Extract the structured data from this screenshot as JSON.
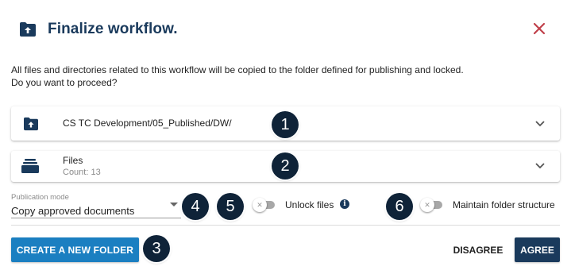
{
  "dialog": {
    "title": "Finalize workflow.",
    "description_line1": "All files and directories related to this workflow will be copied to the folder defined for publishing and locked.",
    "description_line2": "Do you want to proceed?"
  },
  "folder_panel": {
    "path": "CS TC Development/05_Published/DW/",
    "icon": "folder-upload-icon"
  },
  "files_panel": {
    "title": "Files",
    "count_text": "Count: 13",
    "icon": "file-stack-icon"
  },
  "publication_mode": {
    "label": "Publication mode",
    "value": "Copy approved documents"
  },
  "options": {
    "unlock_files": {
      "label": "Unlock files",
      "enabled": false
    },
    "maintain_folder_structure": {
      "label": "Maintain folder structure",
      "enabled": false
    }
  },
  "buttons": {
    "create_folder": "CREATE A NEW FOLDER",
    "disagree": "DISAGREE",
    "agree": "AGREE"
  },
  "callouts": [
    "1",
    "2",
    "3",
    "4",
    "5",
    "6"
  ],
  "colors": {
    "primary_dark": "#1a3a5c",
    "primary_blue": "#1b7fc1",
    "close_red": "#c0404a",
    "callout_bg": "#0f2338"
  }
}
